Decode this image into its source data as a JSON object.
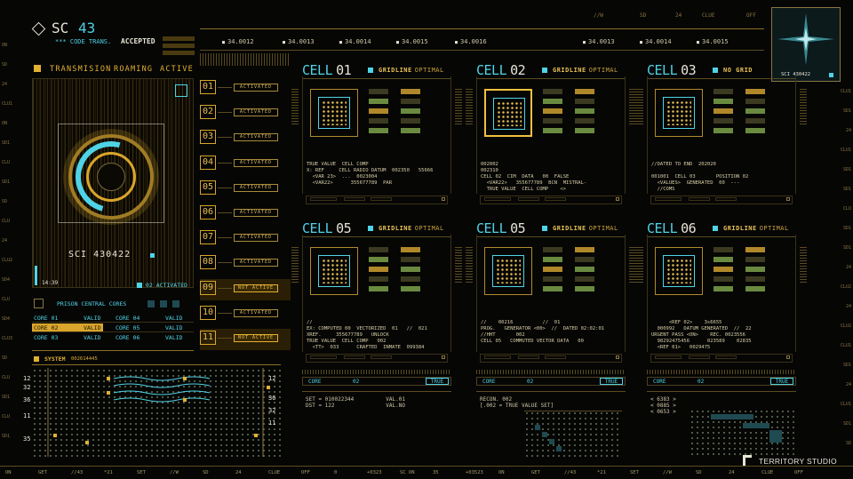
{
  "header": {
    "sc": "SC",
    "sc_num": "43",
    "code": "*** CODE TRANS.",
    "accepted": "ACCEPTED",
    "right_labels": [
      "//W",
      "SD",
      "24",
      "CLUE",
      "OFF"
    ]
  },
  "top_numbers": [
    "34.0012",
    "34.0013",
    "34.0014",
    "34.0015",
    "34.0016",
    "34.0013",
    "34.0014",
    "34.0015"
  ],
  "transmission": {
    "label": "TRANSMISION",
    "roaming": "ROAMING",
    "active": "ACTIVE"
  },
  "sci": "SCI  430422",
  "sci_small": "SCI  430422",
  "activated02": "02 ACTIVATED",
  "small_num": "14:39",
  "prison": {
    "title": "PRISON CENTRAL CORES",
    "rows": [
      [
        "CORE 01",
        "VALID",
        "CORE 04",
        "VALID"
      ],
      [
        "CORE 02",
        "VALID",
        "CORE 05",
        "VALID"
      ],
      [
        "CORE 03",
        "VALID",
        "CORE 06",
        "VALID"
      ]
    ]
  },
  "system": {
    "label": "SYSTEM",
    "code": "002614445"
  },
  "cells": [
    {
      "n": "01",
      "s": "ACTIVATED"
    },
    {
      "n": "02",
      "s": "ACTIVATED"
    },
    {
      "n": "03",
      "s": "ACTIVATED"
    },
    {
      "n": "04",
      "s": "ACTIVATED"
    },
    {
      "n": "05",
      "s": "ACTIVATED"
    },
    {
      "n": "06",
      "s": "ACTIVATED"
    },
    {
      "n": "07",
      "s": "ACTIVATED"
    },
    {
      "n": "08",
      "s": "ACTIVATED"
    },
    {
      "n": "09",
      "s": "NOT ACTIVE"
    },
    {
      "n": "10",
      "s": "ACTIVATED"
    },
    {
      "n": "11",
      "s": "NOT ACTIVE"
    }
  ],
  "panels": [
    {
      "title": "CELL",
      "num": "01",
      "tag": "GRIDLINE",
      "sub": "OPTIMAL",
      "text": "TRUE VALUE  CELL COMP\nX: REF     CELL RADIO DATUM  002350   55666\n  <VAR 23>  ...  0023004\n  <VAR22>      355677789  PAR"
    },
    {
      "title": "CELL",
      "num": "02",
      "tag": "GRIDLINE",
      "sub": "OPTIMAL",
      "text": "002002\n002310\nCELL 02  CIM  DATA   00  FALSE\n  <VAR22>   355677789  BCN  MISTRAL-\n  TRUE VALUE  CELL COMP    <>"
    },
    {
      "title": "CELL",
      "num": "03",
      "tag": "NO GRID",
      "sub": "",
      "text": "//DATED TO END  202020\n\n001001  CELL 03       POSITION 02\n  <VALUES>  GENERATED  00  ---\n  //COMS"
    },
    {
      "title": "CELL",
      "num": "05",
      "tag": "GRIDLINE",
      "sub": "OPTIMAL",
      "text": "//\nEX: COMPUTED 00  VECTORIZED  01   //  021\nXREF.     355677789   UNLOCK\nTRUE VALUE  CELL COMP   002\n  <TT>  033      CRAFTED  INMATE  099384"
    },
    {
      "title": "CELL",
      "num": "05",
      "tag": "GRIDLINE",
      "sub": "OPTIMAL",
      "text": "//    00216          //  01\nPROG.   GENERATOR <00>  //  DATED 02:02:01\n//HHT       002\nCELL 05   COMMUTED VECTOR DATA   00"
    },
    {
      "title": "CELL",
      "num": "06",
      "tag": "GRIDLINE",
      "sub": "OPTIMAL",
      "text": "      <REF 02>    3s6655\n  000992   DATUM GENERATED  //  22\nURGENT PASS <ON>    REC. 0023556\n  98292475456      023589    02835\n  <REF 01>   0029475"
    }
  ],
  "core_bars": [
    {
      "l": "CORE",
      "v": "02",
      "r": "TRUE"
    },
    {
      "l": "CORE",
      "v": "02",
      "r": "TRUE"
    },
    {
      "l": "CORE",
      "v": "02",
      "r": "TRUE"
    }
  ],
  "bottom_texts": [
    "SET = 010022344          VAL.01\nDST = 122                VAL.NO",
    "RECON. 002\n[.002 = TRUE VALUE SET]",
    "< 6383 >\n< 0885 >\n< 0653 >"
  ],
  "left_ticks": [
    "ON",
    "SD",
    "24",
    "CLU1",
    "ON",
    "SD1",
    "CLU",
    "SD1",
    "SD",
    "CLU",
    "24",
    "CLU2",
    "SD4",
    "CLU",
    "SD4",
    "CLU3",
    "SD",
    "CLU",
    "SD1",
    "CLU",
    "SD1"
  ],
  "right_ticks": [
    "CLU1",
    "SD1",
    "24",
    "CLU1",
    "SD1",
    "SD1",
    "CLU",
    "SD1",
    "SD1",
    "24",
    "CLU2",
    "24",
    "CLU2",
    "CLU1",
    "SD1",
    "24",
    "CLU1",
    "SD1",
    "SD"
  ],
  "sys_nums": [
    "12",
    "32",
    "36",
    "11",
    "35"
  ],
  "sys_nums_r": [
    "12",
    "36",
    "32",
    "11"
  ],
  "bottom_row": [
    "ON",
    "GET",
    "//43",
    "*21",
    "SET",
    "//W",
    "SD",
    "24",
    "CLUE",
    "OFF",
    "0",
    "+0323",
    "SC ON",
    "35",
    "+03523",
    "ON",
    "GET",
    "//43",
    "*21",
    "SET",
    "//W",
    "SD",
    "24",
    "CLUE",
    "OFF"
  ],
  "brand": "TERRITORY STUDIO",
  "thumb_label": "SCI  430422",
  "colors": {
    "accent": "#d9a52c",
    "cyan": "#4fd3e6",
    "bg": "#060605"
  }
}
